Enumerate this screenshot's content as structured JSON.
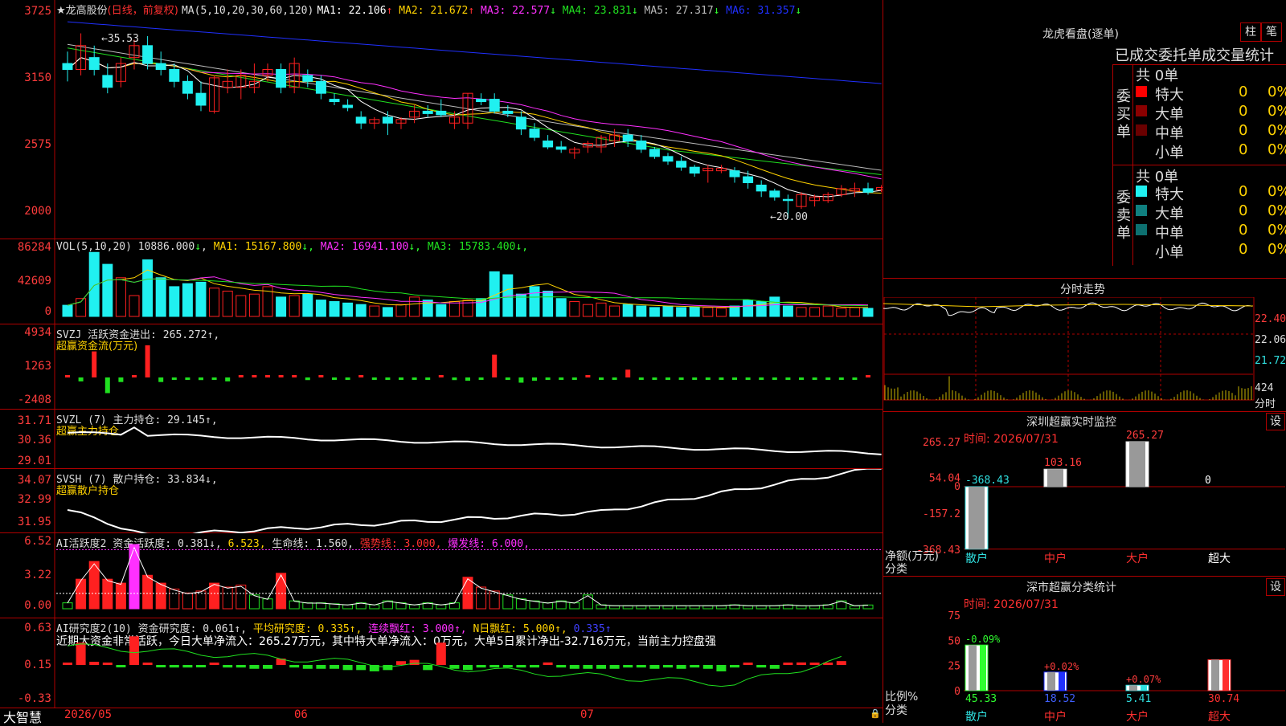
{
  "colors": {
    "up": "#ff2020",
    "down": "#20f0f0",
    "ma_white": "#ffffff",
    "ma_yellow": "#ffd200",
    "ma_magenta": "#ff30ff",
    "ma_green": "#20e020",
    "ma_gray": "#bbbbbb",
    "ma_blue": "#2030ff",
    "grid": "#b00000"
  },
  "main": {
    "title_star": "★",
    "title_name": "龙高股份",
    "title_period": "(日线，前复权)",
    "ma_params": "MA(5,10,20,30,60,120)",
    "ma": [
      {
        "label": "MA1:",
        "value": "22.106",
        "arrow": "↑",
        "color": "#ffffff"
      },
      {
        "label": "MA2:",
        "value": "21.672",
        "arrow": "↑",
        "color": "#ffd200"
      },
      {
        "label": "MA3:",
        "value": "22.577",
        "arrow": "↓",
        "color": "#ff30ff"
      },
      {
        "label": "MA4:",
        "value": "23.831",
        "arrow": "↓",
        "color": "#20e020"
      },
      {
        "label": "MA5:",
        "value": "27.317",
        "arrow": "↓",
        "color": "#bbbbbb"
      },
      {
        "label": "MA6:",
        "value": "31.357",
        "arrow": "↓",
        "color": "#2030ff"
      }
    ],
    "y_ticks": [
      "3725",
      "3150",
      "2575",
      "2000"
    ],
    "high_label": "35.53",
    "low_label": "20.00"
  },
  "vol": {
    "title": "VOL(5,10,20)",
    "value": "10886.000",
    "arrow": "↓",
    "ma": [
      {
        "label": "MA1:",
        "value": "15167.800",
        "arrow": "↓",
        "color": "#ffd200"
      },
      {
        "label": "MA2:",
        "value": "16941.100",
        "arrow": "↓",
        "color": "#ff30ff"
      },
      {
        "label": "MA3:",
        "value": "15783.400",
        "arrow": "↓",
        "color": "#20e020"
      }
    ],
    "y_ticks": [
      "86284",
      "42609",
      "0"
    ]
  },
  "svzj": {
    "title": "SVZJ  活跃资金进出: 265.272↑,",
    "sub": "超赢资金流(万元)",
    "y_ticks": [
      "4934",
      "1263",
      "-2408"
    ]
  },
  "svzl": {
    "title": "SVZL (7) 主力持仓: 29.145↑,",
    "sub": "超赢主力持仓",
    "y_ticks": [
      "31.71",
      "30.36",
      "29.01"
    ]
  },
  "svsh": {
    "title": "SVSH (7) 散户持仓: 33.834↓,",
    "sub": "超赢散户持仓",
    "y_ticks": [
      "34.07",
      "32.99",
      "31.95"
    ]
  },
  "ai1": {
    "title_a": "AI活跃度2 资金活跃度: 0.381↓,",
    "title_b": "6.523,",
    "title_c": "生命线: 1.560,",
    "title_d": "强势线: 3.000,",
    "title_e": "爆发线: 6.000,",
    "y_ticks": [
      "6.52",
      "3.22",
      "0.00"
    ]
  },
  "ai2": {
    "title_a": "AI研究度2(10) 资金研究度: 0.061↑,",
    "title_b": "平均研究度: 0.335↑,",
    "title_c": "连续飘红: 3.000↑,",
    "title_d": "N日飘红: 5.000↑,",
    "title_e": "0.335↑",
    "note": "近期大资金非常活跃，今日大单净流入：265.27万元，其中特大单净流入：0万元，大单5日累计净出-32.716万元，当前主力控盘强",
    "y_ticks": [
      "0.63",
      "0.15",
      "-0.33"
    ]
  },
  "bottom": {
    "logo": "大智慧",
    "dates": [
      "2026/05",
      "06",
      "07"
    ]
  },
  "right": {
    "top_title": "龙虎看盘(逐单)",
    "btn_zhu": "柱",
    "btn_bi": "笔",
    "table_title": "已成交委托单成交量统计",
    "buy": {
      "label": "委买单",
      "total": "共 0单",
      "rows": [
        {
          "name": "特大",
          "val": "0",
          "pct": "0%",
          "color": "#ff0000"
        },
        {
          "name": "大单",
          "val": "0",
          "pct": "0%",
          "color": "#8b0000"
        },
        {
          "name": "中单",
          "val": "0",
          "pct": "0%",
          "color": "#6a0000"
        },
        {
          "name": "小单",
          "val": "0",
          "pct": "0%",
          "color": ""
        }
      ]
    },
    "sell": {
      "label": "委卖单",
      "total": "共 0单",
      "rows": [
        {
          "name": "特大",
          "val": "0",
          "pct": "0%",
          "color": "#20f0f0"
        },
        {
          "name": "大单",
          "val": "0",
          "pct": "0%",
          "color": "#108080"
        },
        {
          "name": "中单",
          "val": "0",
          "pct": "0%",
          "color": "#0d7070"
        },
        {
          "name": "小单",
          "val": "0",
          "pct": "0%",
          "color": ""
        }
      ]
    },
    "fenshi": {
      "title": "分时走势",
      "y_ticks": [
        "22.40",
        "22.06",
        "21.72"
      ],
      "vol": "424",
      "vol_label": "分时"
    },
    "monitor": {
      "title": "深圳超赢实时监控",
      "btn": "设",
      "time": "时间: 2026/07/31",
      "y_ticks": [
        "265.27",
        "54.04",
        "0",
        "-157.2",
        "-368.43"
      ],
      "bars": [
        {
          "label": "散户",
          "value": "-368.43"
        },
        {
          "label": "中户",
          "value": "103.16"
        },
        {
          "label": "大户",
          "value": "265.27"
        },
        {
          "label": "超大",
          "value": "0"
        }
      ],
      "axis_label1": "净额(万元)",
      "axis_label2": "分类"
    },
    "stats": {
      "title": "深市超赢分类统计",
      "btn": "设",
      "time": "时间: 2026/07/31",
      "y_ticks": [
        "75",
        "50",
        "25",
        "0"
      ],
      "bars": [
        {
          "label": "散户",
          "value": "45.33",
          "change": "-0.09%"
        },
        {
          "label": "中户",
          "value": "18.52",
          "change": "+0.02%"
        },
        {
          "label": "大户",
          "value": "5.41",
          "change": "+0.07%"
        },
        {
          "label": "超大",
          "value": "30.74",
          "change": ""
        }
      ],
      "axis_label1": "比例%",
      "axis_label2": "分类"
    }
  },
  "chart_data": [
    {
      "type": "candlestick",
      "title": "龙高股份",
      "ylim": [
        20.0,
        37.25
      ],
      "ohlc": [
        [
          33.0,
          34.0,
          31.5,
          32.5
        ],
        [
          32.5,
          35.53,
          32.0,
          34.5
        ],
        [
          33.5,
          34.5,
          32.0,
          32.5
        ],
        [
          32.0,
          33.0,
          30.5,
          31.0
        ],
        [
          31.5,
          33.5,
          31.0,
          33.0
        ],
        [
          33.5,
          35.0,
          32.5,
          34.5
        ],
        [
          34.5,
          35.3,
          32.5,
          33.0
        ],
        [
          33.0,
          34.0,
          32.0,
          32.5
        ],
        [
          32.5,
          33.0,
          31.0,
          31.5
        ],
        [
          31.5,
          32.0,
          30.0,
          30.5
        ],
        [
          30.5,
          31.5,
          29.0,
          29.5
        ],
        [
          29.0,
          32.0,
          28.8,
          31.8
        ],
        [
          31.0,
          32.5,
          30.5,
          31.5
        ],
        [
          31.0,
          32.5,
          30.0,
          32.0
        ],
        [
          31.0,
          33.0,
          30.5,
          31.5
        ],
        [
          32.0,
          33.0,
          31.5,
          32.5
        ],
        [
          32.5,
          33.0,
          30.5,
          31.0
        ],
        [
          31.0,
          33.5,
          30.5,
          33.0
        ],
        [
          32.0,
          32.5,
          31.0,
          31.5
        ],
        [
          31.5,
          32.0,
          30.0,
          30.5
        ],
        [
          30.0,
          30.5,
          29.5,
          29.8
        ],
        [
          29.5,
          30.0,
          29.0,
          29.3
        ],
        [
          28.5,
          29.0,
          27.5,
          28.0
        ],
        [
          28.0,
          28.5,
          27.5,
          28.3
        ],
        [
          28.5,
          29.0,
          27.0,
          28.0
        ],
        [
          28.0,
          28.5,
          27.5,
          28.3
        ],
        [
          28.5,
          29.5,
          28.0,
          29.0
        ],
        [
          29.0,
          29.5,
          28.5,
          28.8
        ],
        [
          29.0,
          30.0,
          28.5,
          28.7
        ],
        [
          28.0,
          29.0,
          27.5,
          28.5
        ],
        [
          28.0,
          30.5,
          27.5,
          30.5
        ],
        [
          30.0,
          30.5,
          29.5,
          29.8
        ],
        [
          30.0,
          30.5,
          28.8,
          29.0
        ],
        [
          29.0,
          29.5,
          28.5,
          28.8
        ],
        [
          28.5,
          29.0,
          27.0,
          27.5
        ],
        [
          27.5,
          28.0,
          26.5,
          26.8
        ],
        [
          26.5,
          27.0,
          25.8,
          26.0
        ],
        [
          26.0,
          26.5,
          25.5,
          25.8
        ],
        [
          25.5,
          26.0,
          25.0,
          25.8
        ],
        [
          26.0,
          26.5,
          25.5,
          26.3
        ],
        [
          26.0,
          27.0,
          25.5,
          26.8
        ],
        [
          26.5,
          27.5,
          26.0,
          27.0
        ],
        [
          27.0,
          27.5,
          26.0,
          26.5
        ],
        [
          26.5,
          27.0,
          25.5,
          25.8
        ],
        [
          25.8,
          26.0,
          25.0,
          25.2
        ],
        [
          25.2,
          25.5,
          24.5,
          24.8
        ],
        [
          24.8,
          25.2,
          24.0,
          24.3
        ],
        [
          24.3,
          24.5,
          23.5,
          23.8
        ],
        [
          24.0,
          24.5,
          23.0,
          24.2
        ],
        [
          24.0,
          24.5,
          23.8,
          24.2
        ],
        [
          24.0,
          24.3,
          23.0,
          23.5
        ],
        [
          23.5,
          24.0,
          22.5,
          23.0
        ],
        [
          22.8,
          23.2,
          21.8,
          22.3
        ],
        [
          22.3,
          22.5,
          21.5,
          21.8
        ],
        [
          21.6,
          22.0,
          20.0,
          21.5
        ],
        [
          21.0,
          22.2,
          20.8,
          22.0
        ],
        [
          21.5,
          22.0,
          21.0,
          21.8
        ],
        [
          21.5,
          22.2,
          21.3,
          22.0
        ],
        [
          22.0,
          22.8,
          21.8,
          22.5
        ],
        [
          22.3,
          23.0,
          21.8,
          22.5
        ],
        [
          22.5,
          23.0,
          22.0,
          22.2
        ],
        [
          22.4,
          22.8,
          22.2,
          22.6
        ]
      ]
    },
    {
      "type": "bar",
      "title": "VOL(5,10,20)",
      "values": [
        15000,
        24000,
        86000,
        70000,
        52000,
        28000,
        76000,
        52000,
        40000,
        44000,
        46000,
        38000,
        34000,
        28000,
        30000,
        40000,
        26000,
        28000,
        30000,
        22000,
        20000,
        18000,
        16000,
        14000,
        12000,
        16000,
        26000,
        22000,
        16000,
        20000,
        22000,
        24000,
        60000,
        56000,
        30000,
        40000,
        34000,
        24000,
        20000,
        16000,
        18000,
        14000,
        16000,
        14000,
        12000,
        14000,
        12000,
        13000,
        12000,
        11000,
        14000,
        22000,
        20000,
        26000,
        14000,
        12000,
        12000,
        14000,
        11000,
        12000,
        10886
      ]
    }
  ]
}
